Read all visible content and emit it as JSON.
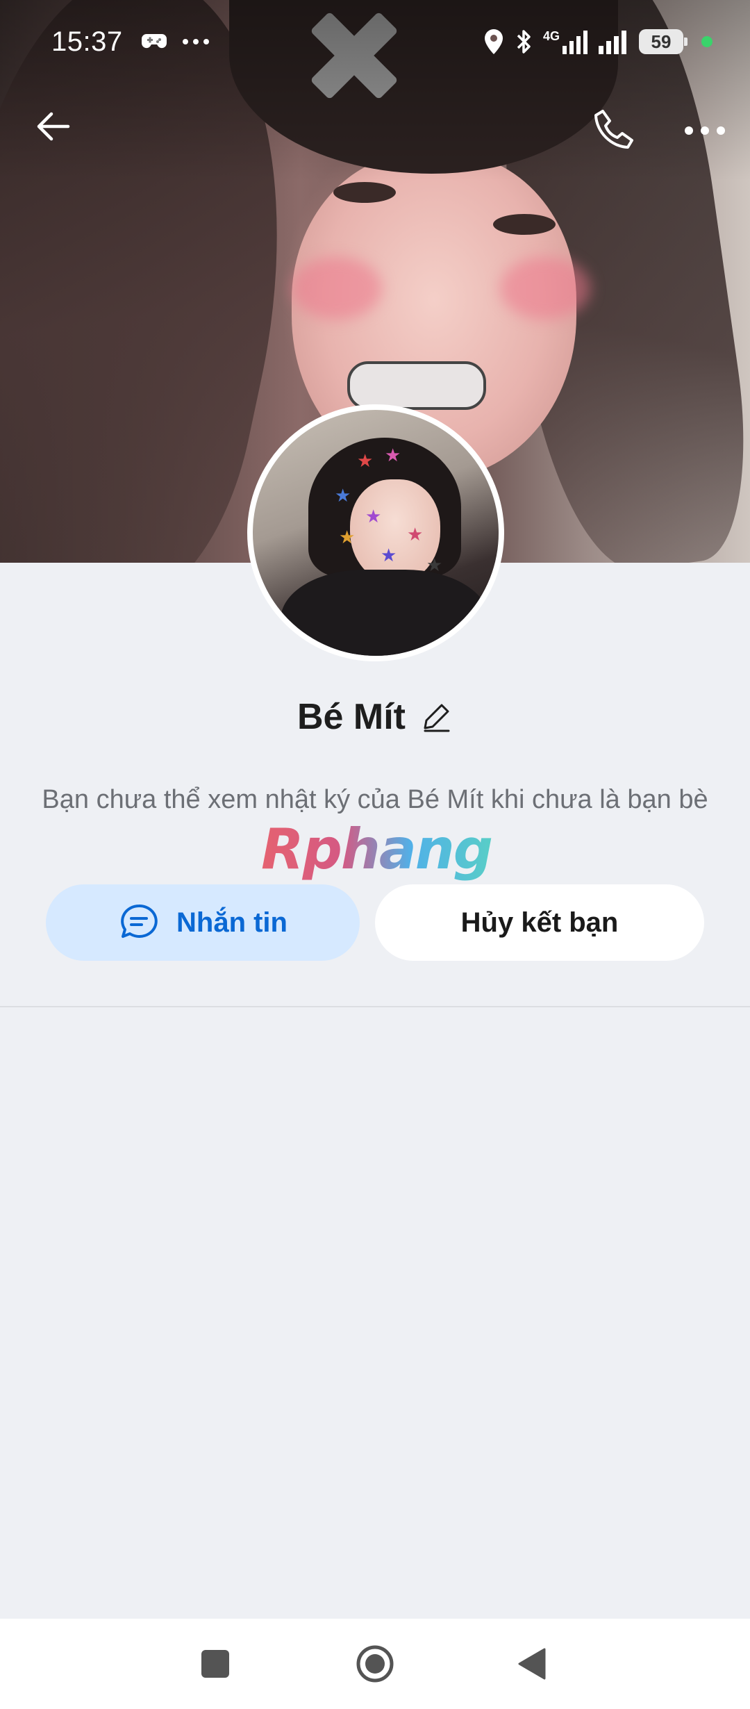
{
  "status_bar": {
    "time": "15:37",
    "network_label": "4G",
    "battery_level": "59",
    "icons": [
      "game-controller-icon",
      "more-dots-icon",
      "location-icon",
      "bluetooth-icon",
      "signal-icon",
      "battery-icon"
    ]
  },
  "top_nav": {
    "icons": [
      "back-arrow-icon",
      "phone-icon",
      "more-icon"
    ]
  },
  "profile": {
    "name": "Bé Mít",
    "notice": "Bạn chưa thể xem nhật ký của Bé Mít khi chưa là bạn bè"
  },
  "watermark": {
    "text": "Rphang"
  },
  "actions": {
    "message_label": "Nhắn tin",
    "unfriend_label": "Hủy kết bạn"
  },
  "colors": {
    "accent": "#0a68d4",
    "message_button_bg": "#d6e9ff",
    "page_bg": "#eef0f4"
  }
}
